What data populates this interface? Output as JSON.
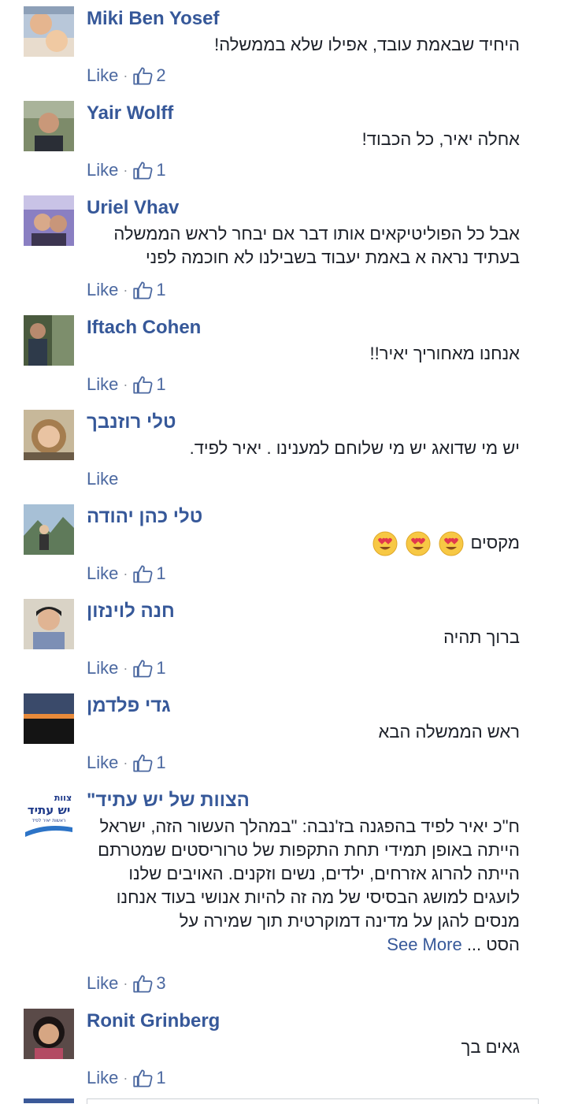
{
  "comments": [
    {
      "name": "Miki Ben Yosef",
      "text": [
        "היחיד שבאמת עובד, אפילו שלא בממשלה!"
      ],
      "like_label": "Like",
      "likes": "2"
    },
    {
      "name": "Yair Wolff",
      "text": [
        "אחלה יאיר, כל הכבוד!"
      ],
      "like_label": "Like",
      "likes": "1"
    },
    {
      "name": "Uriel Vhav",
      "text": [
        "אבל כל הפוליטיקאים אותו דבר אם יבחר לראש הממשלה",
        "בעתיד נראה א באמת יעבוד בשבילנו לא חוכמה לפני"
      ],
      "like_label": "Like",
      "likes": "1"
    },
    {
      "name": "Iftach Cohen",
      "text": [
        "אנחנו מאחוריך יאיר!!"
      ],
      "like_label": "Like",
      "likes": "1"
    },
    {
      "name": "טלי רוזנבך",
      "text": [
        "יש מי שדואג יש מי שלוחם למענינו . יאיר לפיד."
      ],
      "like_label": "Like"
    },
    {
      "name": "טלי כהן יהודה",
      "text": [
        "מקסים"
      ],
      "emoji": "heart-eyes-emoji",
      "like_label": "Like",
      "likes": "1"
    },
    {
      "name": "חנה לוינזון",
      "text": [
        "ברוך תהיה"
      ],
      "like_label": "Like",
      "likes": "1"
    },
    {
      "name": "גדי פלדמן",
      "text": [
        "ראש הממשלה הבא"
      ],
      "like_label": "Like",
      "likes": "1"
    },
    {
      "name": "הצוות של יש עתיד\"",
      "logo_top": "צוות",
      "logo_main": "יש עתיד",
      "logo_sub": "ראשות יאיר לפיד",
      "text": [
        "ח\"כ יאיר לפיד בהפגנה בז'נבה: \"במהלך העשור הזה, ישראל",
        "הייתה באופן תמידי תחת התקפות של טרוריסטים שמטרתם",
        "הייתה להרוג אזרחים, ילדים, נשים וזקנים. האויבים שלנו",
        "לועגים למושג הבסיסי של מה זה להיות אנושי בעוד אנחנו",
        "מנסים להגן על מדינה דמוקרטית תוך שמירה על"
      ],
      "last_line": "הסט ...",
      "see_more": "See More",
      "like_label": "Like",
      "likes": "3"
    },
    {
      "name": "Ronit Grinberg",
      "text": [
        "גאים בך"
      ],
      "like_label": "Like",
      "likes": "1"
    }
  ],
  "colors": {
    "link": "#365899",
    "text": "#1d2129",
    "meta": "#90949c"
  },
  "icons": {
    "like": "thumbs-up-icon"
  }
}
